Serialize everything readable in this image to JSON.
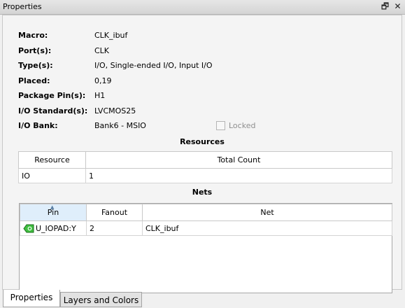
{
  "window": {
    "title": "Properties",
    "restore_icon": "🗗",
    "close_icon": "✕"
  },
  "properties": [
    {
      "label": "Macro:",
      "value": "CLK_ibuf"
    },
    {
      "label": "Port(s):",
      "value": "CLK"
    },
    {
      "label": "Type(s):",
      "value": "I/O, Single-ended I/O, Input I/O"
    },
    {
      "label": "Placed:",
      "value": "0,19"
    },
    {
      "label": "Package Pin(s):",
      "value": "H1"
    },
    {
      "label": "I/O Standard(s):",
      "value": "LVCMOS25"
    },
    {
      "label": "I/O Bank:",
      "value": "Bank6 - MSIO"
    }
  ],
  "locked": {
    "label": "Locked",
    "checked": false
  },
  "resources": {
    "title": "Resources",
    "columns": [
      "Resource",
      "Total Count"
    ],
    "rows": [
      [
        "IO",
        "1"
      ]
    ]
  },
  "nets": {
    "title": "Nets",
    "columns": [
      "Pin",
      "Fanout",
      "Net"
    ],
    "rows": [
      [
        "U_IOPAD:Y",
        "2",
        "CLK_ibuf"
      ]
    ],
    "sort_indicator": "▲"
  },
  "tabs": [
    {
      "label": "Properties",
      "active": true
    },
    {
      "label": "Layers and Colors",
      "active": false
    }
  ],
  "colors": {
    "pin_icon_fill": "#3fbf3f",
    "header_sorted_bg": "#dfeefb"
  }
}
